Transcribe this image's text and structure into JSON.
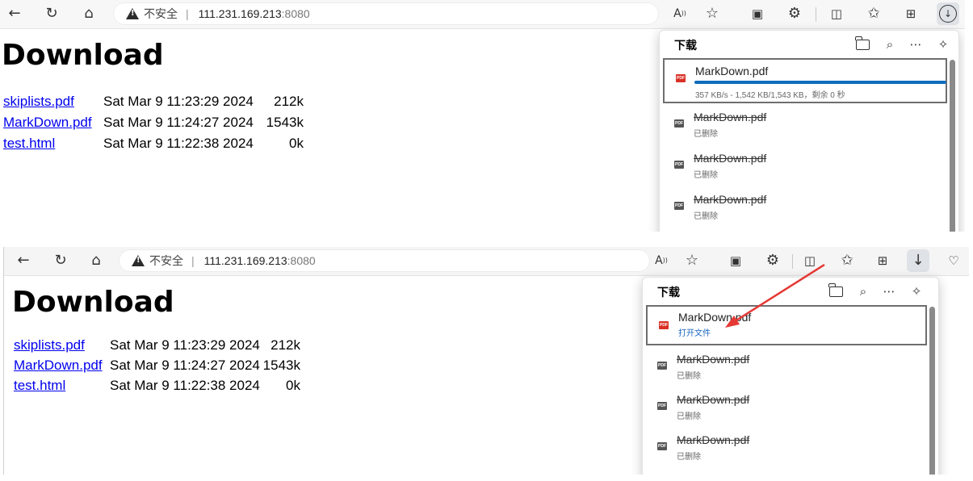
{
  "browser": {
    "insecure_label": "不安全",
    "url_host": "111.231.169.213",
    "url_port": ":8080"
  },
  "page": {
    "title": "Download",
    "files": [
      {
        "name": "skiplists.pdf",
        "date": "Sat Mar 9 11:23:29 2024",
        "size": "212k"
      },
      {
        "name": "MarkDown.pdf",
        "date": "Sat Mar 9 11:24:27 2024",
        "size": "1543k"
      },
      {
        "name": "test.html",
        "date": "Sat Mar 9 11:22:38 2024",
        "size": "0k"
      }
    ]
  },
  "downloads_panel": {
    "title": "下载",
    "pdf_badge": "PDF",
    "deleted_label": "已删除",
    "open_file_label": "打开文件",
    "current_item": {
      "name": "MarkDown.pdf",
      "status": "357 KB/s - 1,542 KB/1,543 KB，剩余 0 秒",
      "progress_fraction": 0.9994
    },
    "history_items": [
      {
        "name": "MarkDown.pdf"
      },
      {
        "name": "MarkDown.pdf"
      },
      {
        "name": "MarkDown.pdf"
      }
    ]
  },
  "colors": {
    "link": "#0000ee",
    "progress": "#0f6cbd",
    "arrow": "#e53935",
    "pdf_icon_red": "#d93025"
  },
  "icons": [
    "back-arrow-icon",
    "refresh-icon",
    "home-icon",
    "warning-icon",
    "read-aloud-icon",
    "favorite-star-icon",
    "collections-icon",
    "extensions-icon",
    "split-screen-icon",
    "favorites-icon",
    "tab-collections-icon",
    "download-icon",
    "health-icon",
    "folder-icon",
    "search-icon",
    "more-icon",
    "pin-icon",
    "pdf-icon"
  ]
}
